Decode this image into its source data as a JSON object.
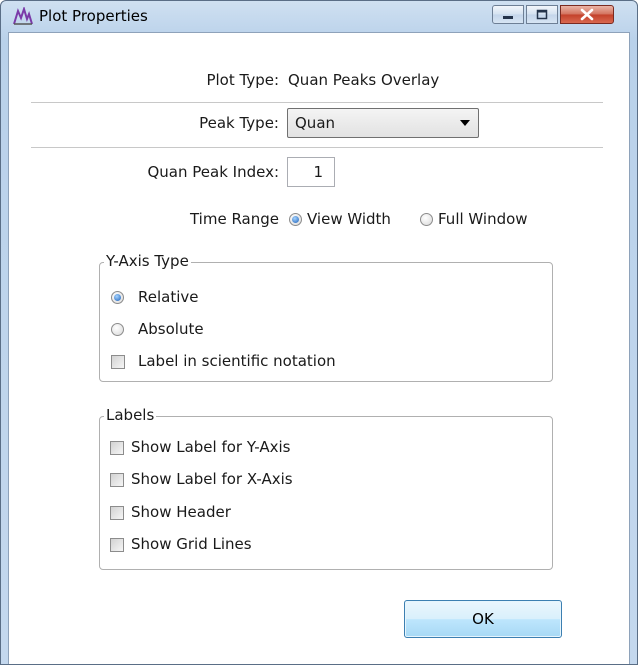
{
  "window": {
    "title": "Plot Properties",
    "controls": {
      "minimize": "minimize",
      "maximize": "maximize",
      "close": "close"
    }
  },
  "plot_type": {
    "label": "Plot Type:",
    "value": "Quan Peaks Overlay"
  },
  "peak_type": {
    "label": "Peak Type:",
    "selected": "Quan"
  },
  "quan_peak_index": {
    "label": "Quan Peak Index:",
    "value": "1"
  },
  "time_range": {
    "label": "Time Range",
    "options": [
      {
        "label": "View Width",
        "checked": true
      },
      {
        "label": "Full Window",
        "checked": false
      }
    ]
  },
  "y_axis_type": {
    "title": "Y-Axis Type",
    "options": [
      {
        "label": "Relative",
        "checked": true
      },
      {
        "label": "Absolute",
        "checked": false
      }
    ],
    "scientific": {
      "label": "Label in scientific notation",
      "checked": false
    }
  },
  "labels": {
    "title": "Labels",
    "items": [
      {
        "label": "Show Label for Y-Axis",
        "checked": false
      },
      {
        "label": "Show Label for X-Axis",
        "checked": false
      },
      {
        "label": "Show Header",
        "checked": false
      },
      {
        "label": "Show Grid Lines",
        "checked": false
      }
    ]
  },
  "ok_button": {
    "label": "OK"
  },
  "colors": {
    "accent": "#1b5fb8",
    "title_bar": "#b9d1ea",
    "close_button": "#c3402a"
  }
}
